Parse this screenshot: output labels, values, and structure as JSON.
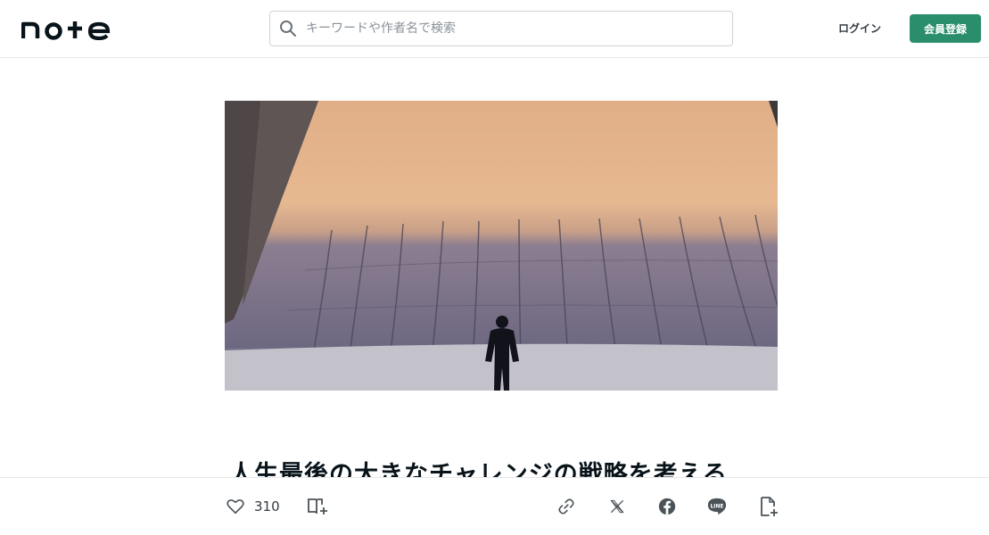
{
  "header": {
    "logo_text": "note",
    "search_placeholder": "キーワードや作者名で検索",
    "login_label": "ログイン",
    "signup_label": "会員登録",
    "signup_color": "#2a8e6c"
  },
  "article": {
    "title": "人生最後の大きなチャレンジの戦略を考える"
  },
  "bottom_bar": {
    "like_count": "310",
    "icons": [
      "heart-icon",
      "magazine-add-icon",
      "link-icon",
      "x-icon",
      "facebook-icon",
      "line-icon",
      "note-add-icon"
    ]
  }
}
